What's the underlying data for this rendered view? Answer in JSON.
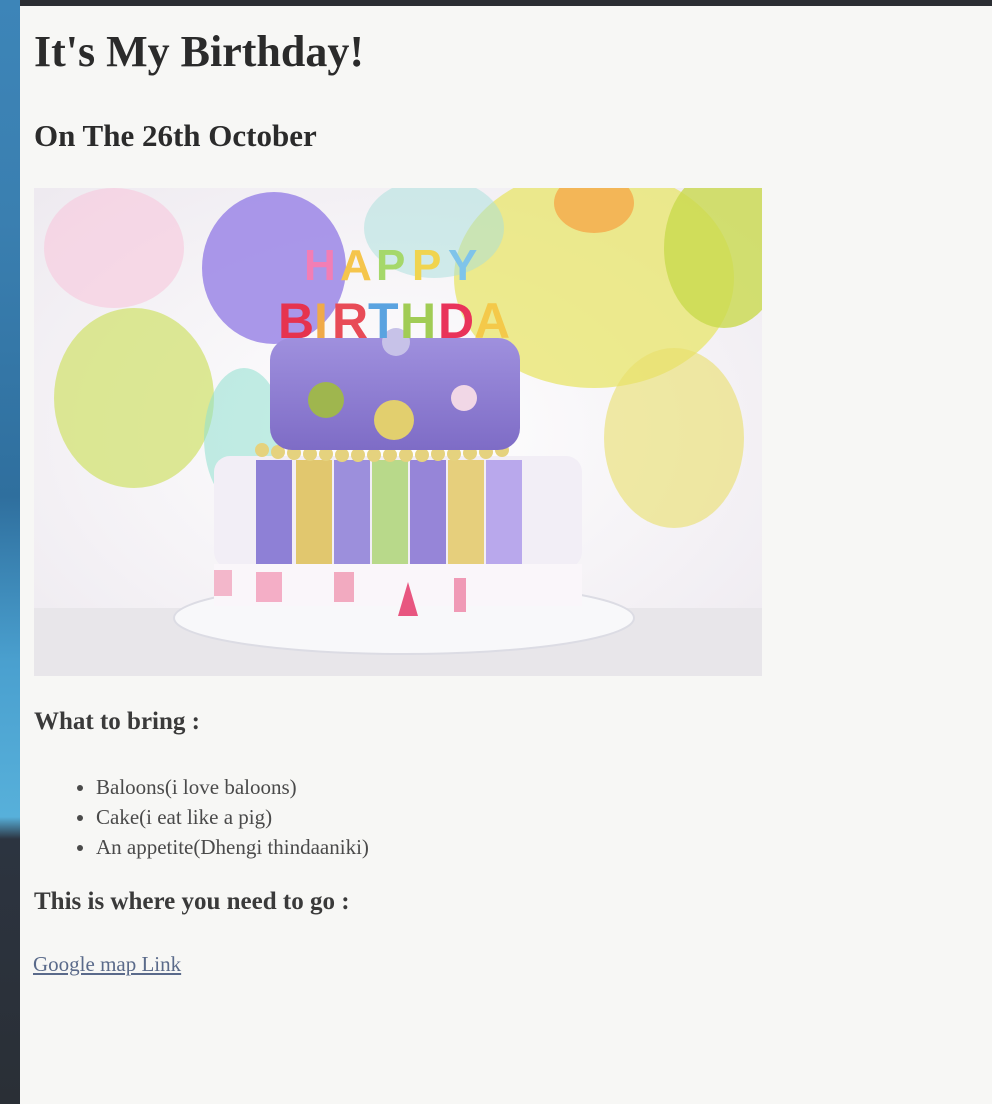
{
  "page": {
    "title": "It's My Birthday!",
    "subtitle": "On The 26th October"
  },
  "image": {
    "alt": "Happy Birthday cake with balloons",
    "candle_text_line1": "HAPPY",
    "candle_text_line2": "BIRTHDAY"
  },
  "bring": {
    "heading": "What to bring :",
    "items": [
      "Baloons(i love baloons)",
      "Cake(i eat like a pig)",
      "An appetite(Dhengi thindaaniki)"
    ]
  },
  "directions": {
    "heading": "This is where you need to go :",
    "link_label": "Google map Link"
  }
}
